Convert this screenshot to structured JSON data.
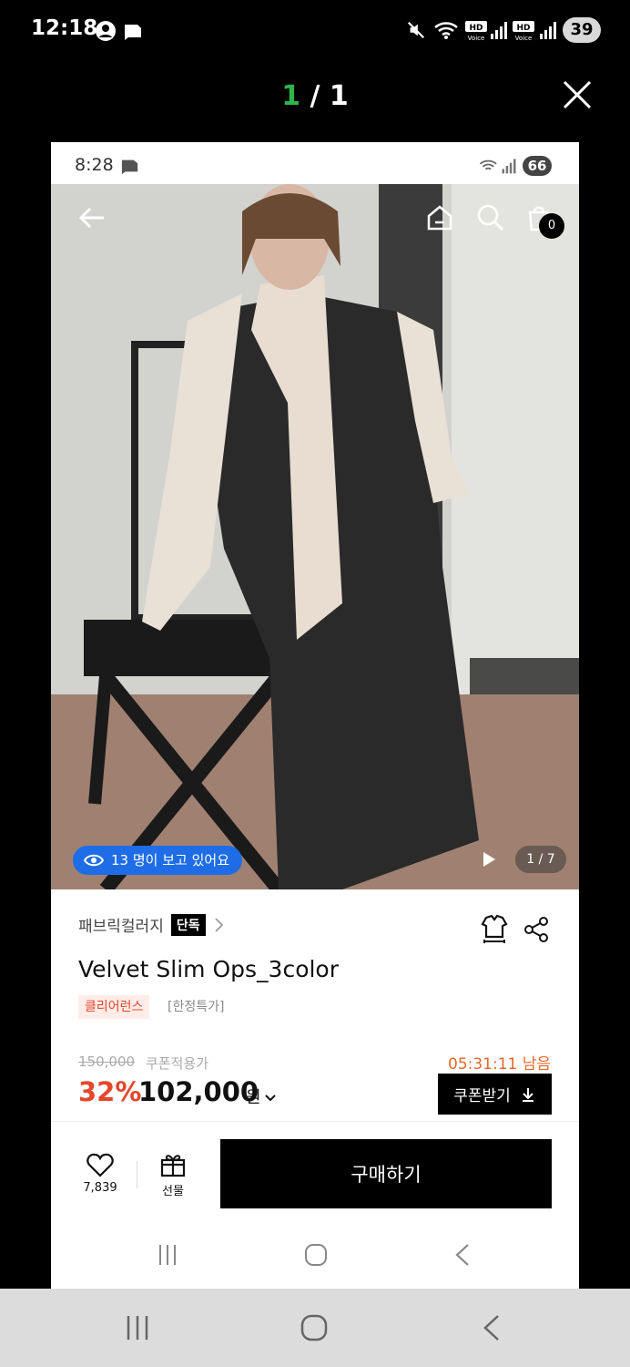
{
  "status_bar": {
    "time": "12:18",
    "battery": "39"
  },
  "viewer": {
    "current": "1",
    "separator": " / ",
    "total": "1"
  },
  "inner_status": {
    "time": "8:28",
    "battery": "66"
  },
  "photo": {
    "cart_count": "0",
    "viewing_text": "13 명이 보고 있어요",
    "pager": "1 / 7"
  },
  "product": {
    "brand": "패브릭컬러지",
    "exclusive_badge": "단독",
    "title": "Velvet Slim Ops_3color",
    "tags": [
      "클리어런스",
      "[한정특가]"
    ],
    "original_price": "150,000",
    "coupon_label": "쿠폰적용가",
    "timer": "05:31:11 남음",
    "discount": "32%",
    "price": "102,000",
    "currency": "원",
    "coupon_button": "쿠폰받기"
  },
  "bottom_bar": {
    "likes": "7,839",
    "gift_label": "선물",
    "buy_label": "구매하기"
  },
  "colors": {
    "accent_orange": "#e5472b",
    "viewing_blue": "#1f6de6",
    "counter_green": "#2fb34a"
  }
}
